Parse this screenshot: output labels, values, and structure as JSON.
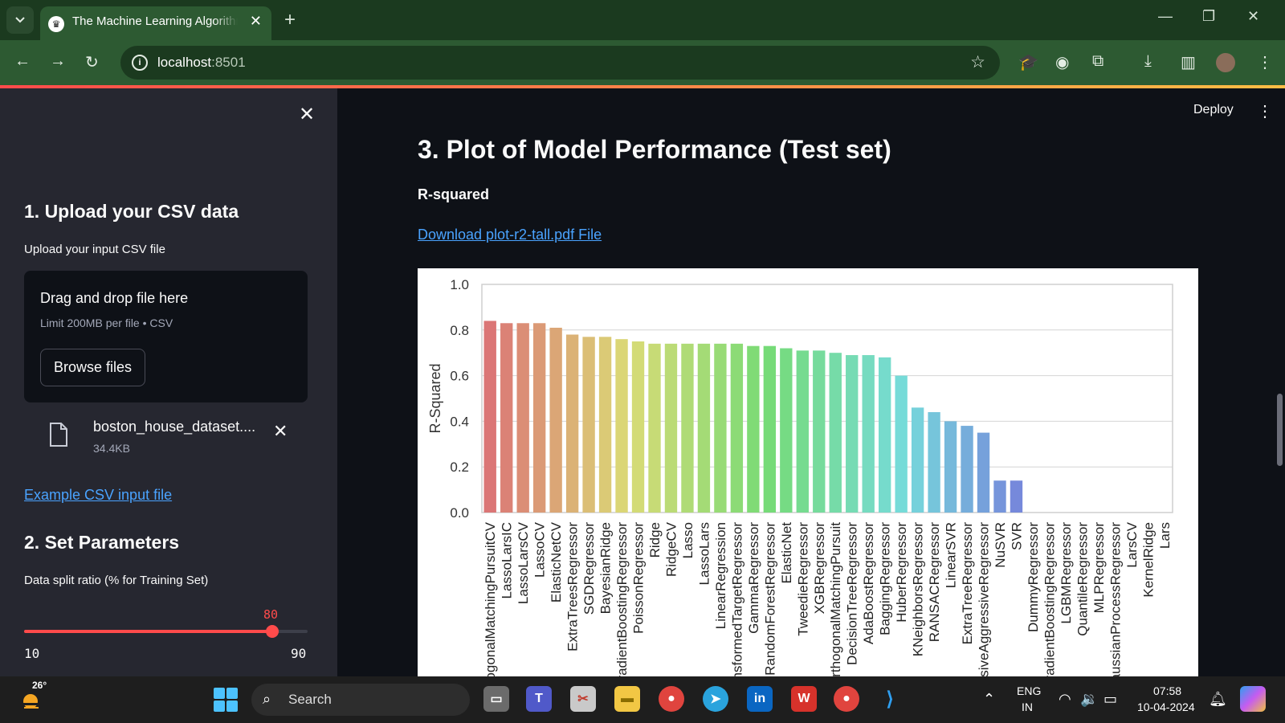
{
  "browser": {
    "tab_title": "The Machine Learning Algorithm",
    "tab_close": "✕",
    "new_tab": "+",
    "url_host": "localhost",
    "url_port": ":8501",
    "win_min": "—",
    "win_max": "❐",
    "win_close": "✕"
  },
  "sidebar": {
    "close": "✕",
    "section1_title": "1. Upload your CSV data",
    "upload_label": "Upload your input CSV file",
    "dropzone_title": "Drag and drop file here",
    "dropzone_limit": "Limit 200MB per file • CSV",
    "browse_label": "Browse files",
    "file_name": "boston_house_dataset....",
    "file_size": "34.4KB",
    "file_remove": "✕",
    "example_link": "Example CSV input file",
    "section2_title": "2. Set Parameters",
    "slider_label": "Data split ratio (% for Training Set)",
    "slider_value": 80,
    "slider_value_text": "80",
    "slider_min": 10,
    "slider_min_text": "10",
    "slider_max": 90,
    "slider_max_text": "90"
  },
  "main": {
    "deploy_label": "Deploy",
    "menu_glyph": "⋮",
    "title": "3. Plot of Model Performance (Test set)",
    "subtitle": "R-squared",
    "download_link": "Download plot-r2-tall.pdf File"
  },
  "chart_data": {
    "type": "bar",
    "ylabel": "R-Squared",
    "xlabel": "",
    "ylim": [
      0,
      1.0
    ],
    "yticks": [
      "0.0",
      "0.2",
      "0.4",
      "0.6",
      "0.8",
      "1.0"
    ],
    "grid": true,
    "categories": [
      "OrthogonalMatchingPursuitCV",
      "LassoLarsIC",
      "LassoLarsCV",
      "LassoCV",
      "ElasticNetCV",
      "ExtraTreesRegressor",
      "SGDRegressor",
      "BayesianRidge",
      "GradientBoostingRegressor",
      "PoissonRegressor",
      "Ridge",
      "RidgeCV",
      "Lasso",
      "LassoLars",
      "LinearRegression",
      "TransformedTargetRegressor",
      "GammaRegressor",
      "RandomForestRegressor",
      "ElasticNet",
      "TweedieRegressor",
      "XGBRegressor",
      "OrthogonalMatchingPursuit",
      "DecisionTreeRegressor",
      "AdaBoostRegressor",
      "BaggingRegressor",
      "HuberRegressor",
      "KNeighborsRegressor",
      "RANSACRegressor",
      "LinearSVR",
      "ExtraTreeRegressor",
      "PassiveAggressiveRegressor",
      "NuSVR",
      "SVR",
      "DummyRegressor",
      "HistGradientBoostingRegressor",
      "LGBMRegressor",
      "QuantileRegressor",
      "MLPRegressor",
      "GaussianProcessRegressor",
      "LarsCV",
      "KernelRidge",
      "Lars"
    ],
    "values": [
      0.84,
      0.83,
      0.83,
      0.83,
      0.81,
      0.78,
      0.77,
      0.77,
      0.76,
      0.75,
      0.74,
      0.74,
      0.74,
      0.74,
      0.74,
      0.74,
      0.73,
      0.73,
      0.72,
      0.71,
      0.71,
      0.7,
      0.69,
      0.69,
      0.68,
      0.6,
      0.46,
      0.44,
      0.4,
      0.38,
      0.35,
      0.14,
      0.14,
      0,
      0,
      0,
      0,
      0,
      0,
      0,
      0,
      0
    ]
  },
  "taskbar": {
    "weather_temp": "26°",
    "search_placeholder": "Search",
    "lang1": "ENG",
    "lang2": "IN",
    "time": "07:58",
    "date": "10-04-2024"
  },
  "colors": {
    "accent": "#ff4b4b",
    "link": "#4aa3ff",
    "sidebar_bg": "#262730",
    "main_bg": "#0e1117",
    "browser_frame": "#2d5a32"
  }
}
